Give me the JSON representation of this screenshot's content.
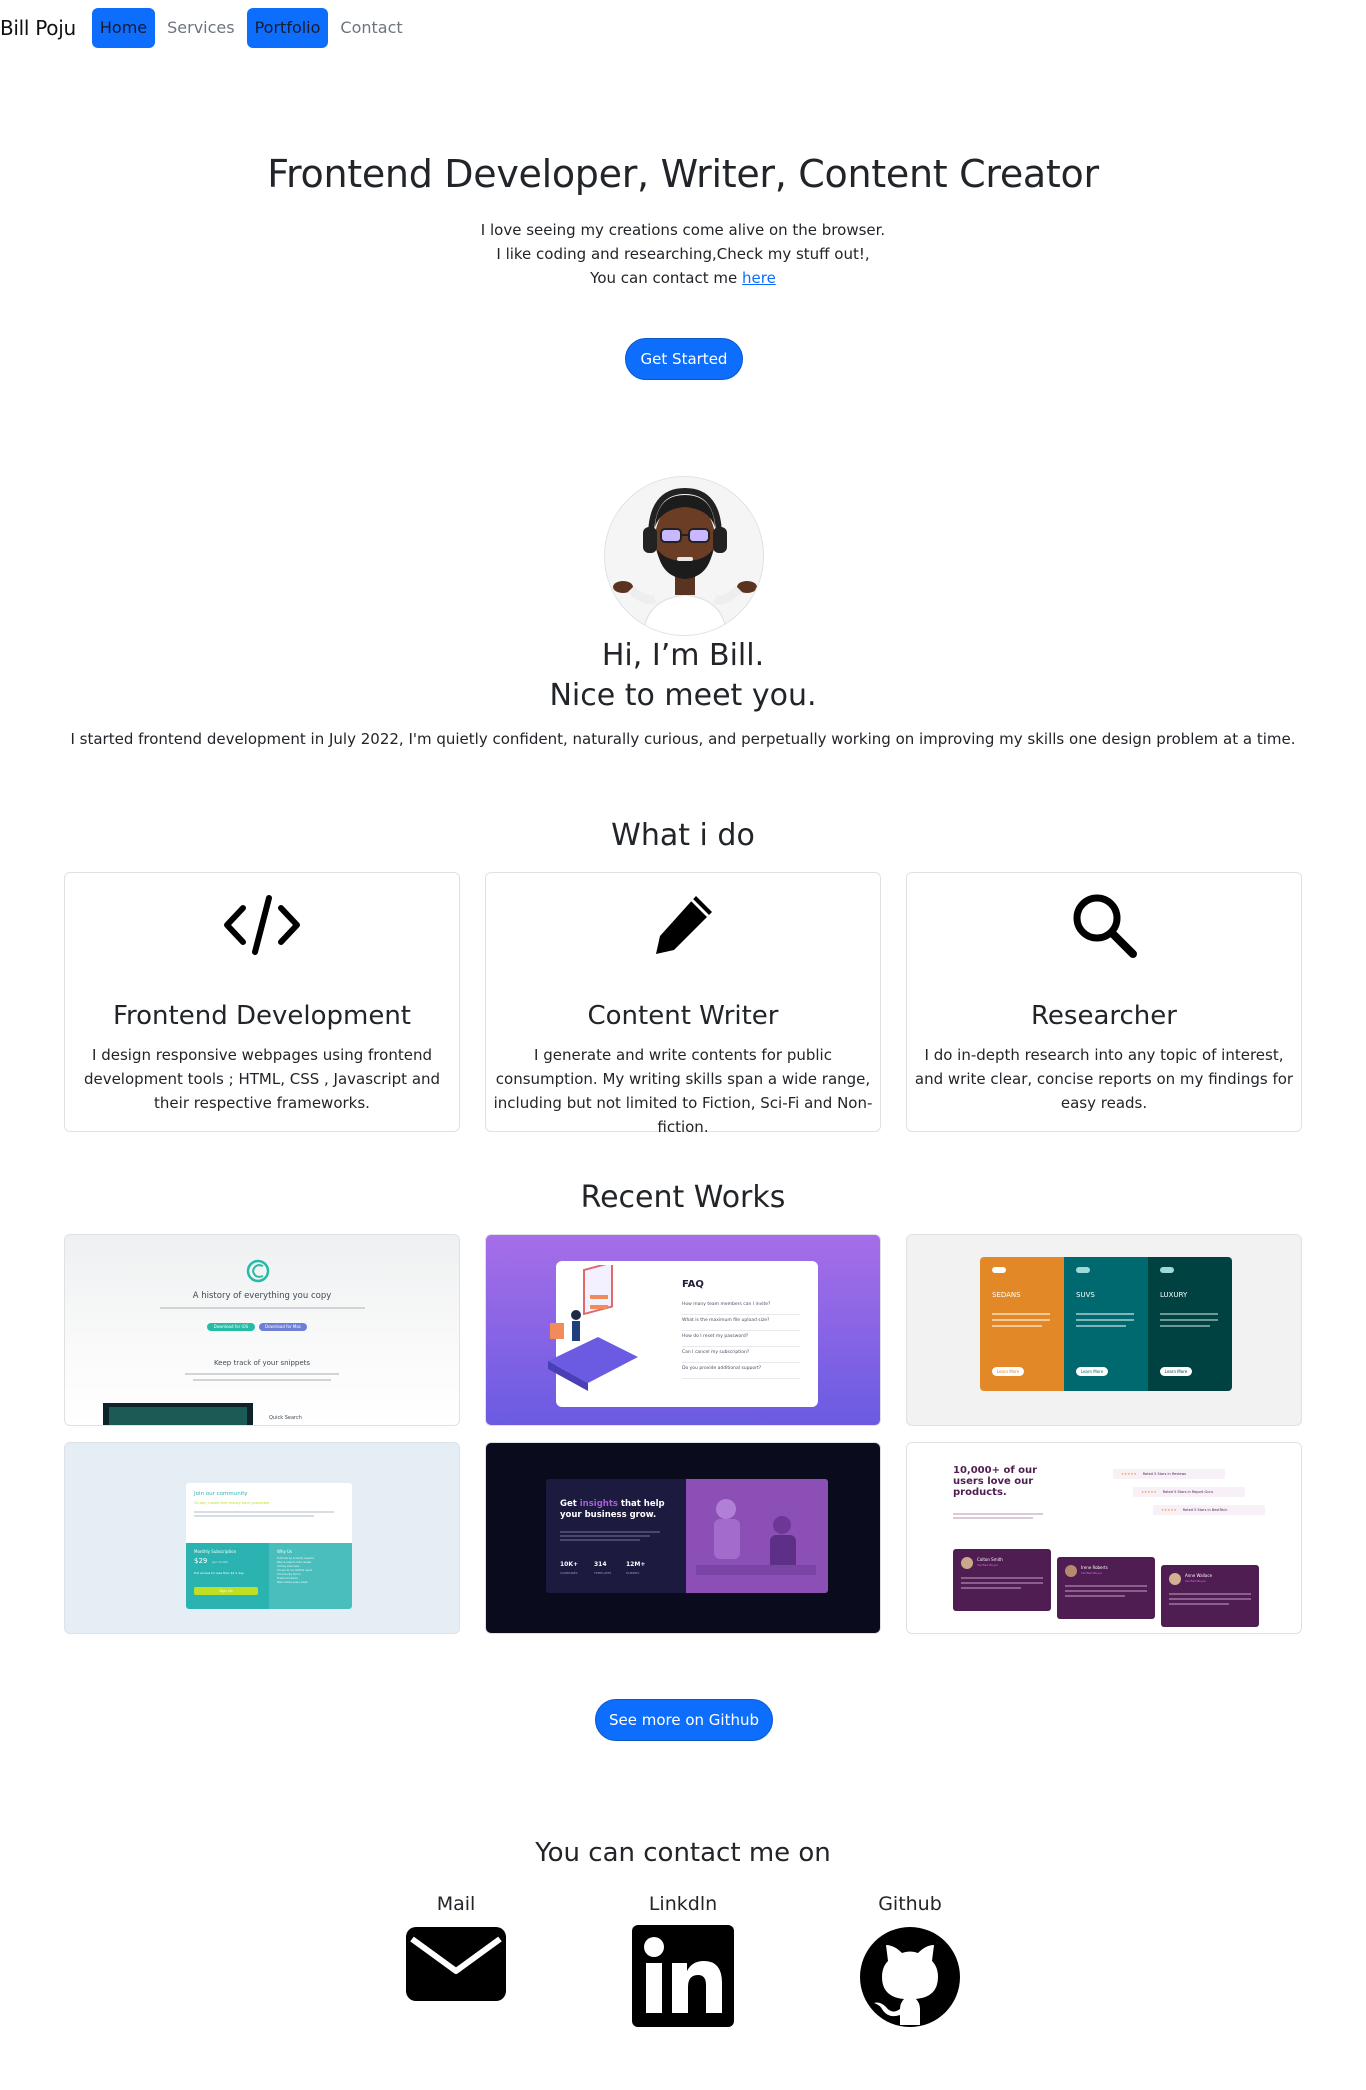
{
  "nav": {
    "brand": "Bill Poju",
    "links": [
      "Home",
      "Services",
      "Portfolio",
      "Contact"
    ]
  },
  "hero": {
    "title": "Frontend Developer, Writer, Content Creator",
    "line1": "I love seeing my creations come alive on the browser.",
    "line2": "I like coding and researching,Check my stuff out!,",
    "line3_prefix": "You can contact me ",
    "line3_link": "here",
    "button": "Get Started"
  },
  "about": {
    "greeting": "Hi, I’m Bill.",
    "subgreeting": "Nice to meet you.",
    "bio": "I started frontend development in July 2022, I'm quietly confident, naturally curious, and perpetually working on improving my skills one design problem at a time."
  },
  "services": {
    "title": "What i do",
    "cards": [
      {
        "icon": "code-icon",
        "title": "Frontend Development",
        "text": "I design responsive webpages using frontend development tools ; HTML, CSS , Javascript and their respective frameworks."
      },
      {
        "icon": "pencil-icon",
        "title": "Content Writer",
        "text": "I generate and write contents for public consumption. My writing skills span a wide range, including but not limited to Fiction, Sci-Fi and Non-fiction."
      },
      {
        "icon": "search-icon",
        "title": "Researcher",
        "text": "I do in-depth research into any topic of interest, and write clear, concise reports on my findings for easy reads."
      }
    ]
  },
  "works": {
    "title": "Recent Works",
    "items": [
      {
        "heading": "A history of everything you copy",
        "subheading": "Keep track of your snippets",
        "btn1": "Download for iOS",
        "btn2": "Download for Mac",
        "caption": "Quick Search"
      },
      {
        "heading": "FAQ",
        "questions": [
          "How many team members can I invite?",
          "What is the maximum file upload size?",
          "How do I reset my password?",
          "Can I cancel my subscription?",
          "Do you provide additional support?"
        ]
      },
      {
        "columns": [
          {
            "name": "SEDANS",
            "btn": "Learn More",
            "color": "#e38826"
          },
          {
            "name": "SUVS",
            "btn": "Learn More",
            "color": "#006970"
          },
          {
            "name": "LUXURY",
            "btn": "Learn More",
            "color": "#004241"
          }
        ]
      },
      {
        "heading": "Join our community",
        "tagline": "30-day, hassle-free money back guarantee",
        "sub_title": "Monthly Subscription",
        "price": "$29",
        "price_unit": "per month",
        "sub_note": "Full access for less than $1 a day",
        "cta": "Sign Up",
        "why_title": "Why Us",
        "why_items": [
          "Tutorials by industry experts",
          "Peer & expert code review",
          "Coding exercises",
          "Access to our GitHub repos",
          "Community forum",
          "Flashcard decks",
          "New videos every week"
        ]
      },
      {
        "heading_prefix": "Get ",
        "heading_accent": "insights",
        "heading_suffix": " that help your business grow.",
        "stats": [
          {
            "value": "10K+",
            "label": "COMPANIES"
          },
          {
            "value": "314",
            "label": "TEMPLATES"
          },
          {
            "value": "12M+",
            "label": "QUERIES"
          }
        ]
      },
      {
        "heading": "10,000+ of our users love our products.",
        "ratings": [
          "Rated 5 Stars in Reviews",
          "Rated 5 Stars in Report Guru",
          "Rated 5 Stars in BestTech"
        ],
        "reviewers": [
          {
            "name": "Colton Smith",
            "tag": "Verified Buyer"
          },
          {
            "name": "Irene Roberts",
            "tag": "Verified Buyer"
          },
          {
            "name": "Anne Wallace",
            "tag": "Verified Buyer"
          }
        ]
      }
    ],
    "button": "See more on Github"
  },
  "contact": {
    "title": "You can contact me on",
    "items": [
      {
        "label": "Mail",
        "icon": "envelope-icon"
      },
      {
        "label": "Linkdln",
        "icon": "linkedin-icon"
      },
      {
        "label": "Github",
        "icon": "github-icon"
      }
    ]
  },
  "colors": {
    "primary": "#0d6efd",
    "faq_gradient_top": "#a66ee8",
    "faq_gradient_bottom": "#6a5be2",
    "insights_bg": "#0b0b1e",
    "insights_accent": "#aa5cdb",
    "testimonial_purple": "#4f1d51"
  }
}
